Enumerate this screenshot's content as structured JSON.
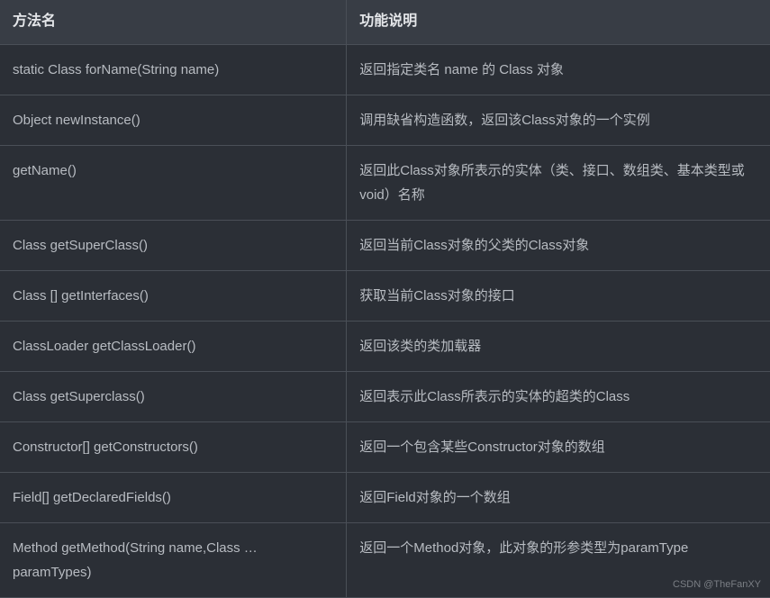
{
  "table": {
    "headers": {
      "col1": "方法名",
      "col2": "功能说明"
    },
    "rows": [
      {
        "method": "static  Class forName(String  name)",
        "desc": "返回指定类名  name  的  Class  对象"
      },
      {
        "method": "Object  newInstance()",
        "desc": "调用缺省构造函数，返回该Class对象的一个实例"
      },
      {
        "method": "getName()",
        "desc": "返回此Class对象所表示的实体（类、接口、数组类、基本类型或void）名称"
      },
      {
        "method": "Class  getSuperClass()",
        "desc": "返回当前Class对象的父类的Class对象"
      },
      {
        "method": "Class  [] getInterfaces()",
        "desc": "获取当前Class对象的接口"
      },
      {
        "method": "ClassLoader  getClassLoader()",
        "desc": "返回该类的类加载器"
      },
      {
        "method": "Class  getSuperclass()",
        "desc": "返回表示此Class所表示的实体的超类的Class"
      },
      {
        "method": "Constructor[]  getConstructors()",
        "desc": "返回一个包含某些Constructor对象的数组"
      },
      {
        "method": "Field[]  getDeclaredFields()",
        "desc": "返回Field对象的一个数组"
      },
      {
        "method": "Method  getMethod(String  name,Class … paramTypes)",
        "desc": "返回一个Method对象，此对象的形参类型为paramType"
      }
    ]
  },
  "watermark": "CSDN @TheFanXY"
}
